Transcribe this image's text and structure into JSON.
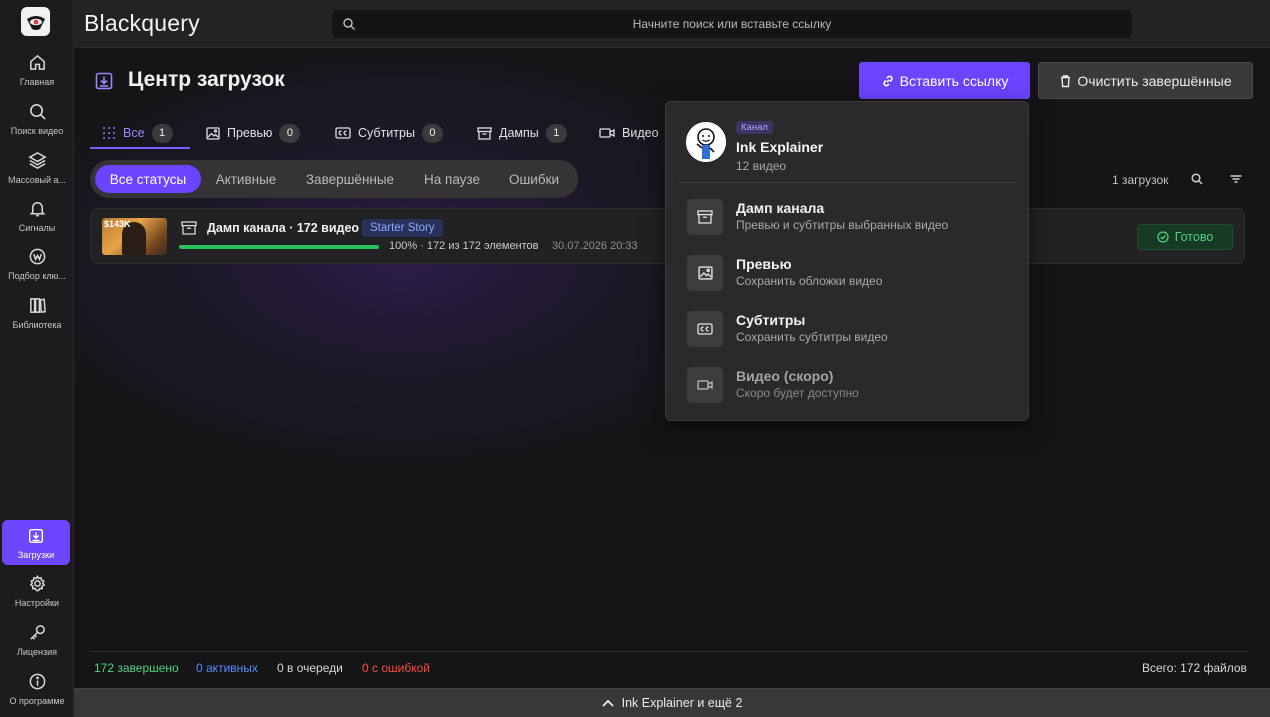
{
  "app": {
    "title": "Blackquery"
  },
  "search": {
    "placeholder": "Начните поиск или вставьте ссылку"
  },
  "sidebar": {
    "items": [
      {
        "label": "Главная",
        "icon": "home-icon"
      },
      {
        "label": "Поиск видео",
        "icon": "search-icon"
      },
      {
        "label": "Массовый а...",
        "icon": "layers-icon"
      },
      {
        "label": "Сигналы",
        "icon": "bell-icon"
      },
      {
        "label": "Подбор клю...",
        "icon": "keyword-icon"
      },
      {
        "label": "Библиотека",
        "icon": "library-icon"
      },
      {
        "label": "Загрузки",
        "icon": "download-icon"
      },
      {
        "label": "Настройки",
        "icon": "gear-icon"
      },
      {
        "label": "Лицензия",
        "icon": "key-icon"
      },
      {
        "label": "О программе",
        "icon": "info-icon"
      }
    ]
  },
  "page": {
    "title": "Центр загрузок",
    "paste_button": "Вставить ссылку",
    "clear_button": "Очистить завершённые"
  },
  "tabs": [
    {
      "label": "Все",
      "count": "1"
    },
    {
      "label": "Превью",
      "count": "0"
    },
    {
      "label": "Субтитры",
      "count": "0"
    },
    {
      "label": "Дампы",
      "count": "1"
    },
    {
      "label": "Видео",
      "count": ""
    }
  ],
  "filters": [
    "Все статусы",
    "Активные",
    "Завершённые",
    "На паузе",
    "Ошибки"
  ],
  "list": {
    "count_label": "1 загрузок"
  },
  "download": {
    "thumb_text": "$143K",
    "title": "Дамп канала · 172 видео",
    "tag": "Starter Story",
    "progress": 1.0,
    "stats": "100% · 172 из 172 элементов",
    "date": "30.07.2026 20:33",
    "status": "Готово"
  },
  "menu": {
    "chip": "Канал",
    "channel_name": "Ink Explainer",
    "channel_sub": "12 видео",
    "items": [
      {
        "title": "Дамп канала",
        "desc": "Превью и субтитры выбранных видео"
      },
      {
        "title": "Превью",
        "desc": "Сохранить обложки видео"
      },
      {
        "title": "Субтитры",
        "desc": "Сохранить субтитры видео"
      },
      {
        "title": "Видео (скоро)",
        "desc": "Скоро будет доступно"
      }
    ]
  },
  "summary": {
    "completed": "172 завершено",
    "active": "0 активных",
    "queued": "0 в очереди",
    "errors": "0 с ошибкой",
    "total": "Всего: 172 файлов"
  },
  "bottom": {
    "label": "Ink Explainer и ещё 2"
  },
  "colors": {
    "accent": "#6a44ff",
    "success": "#4fd27e",
    "info": "#5a8cff",
    "error": "#ff4b3e"
  }
}
